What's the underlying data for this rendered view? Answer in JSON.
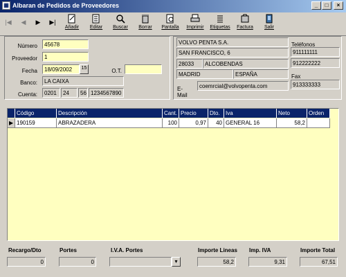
{
  "window": {
    "title": "Albaran de Pedidos de Proveedores"
  },
  "toolbar": {
    "buttons": [
      {
        "label": "Añadir"
      },
      {
        "label": "Editar"
      },
      {
        "label": "Buscar"
      },
      {
        "label": "Borrar"
      },
      {
        "label": "Pantalla"
      },
      {
        "label": "Imprimir"
      },
      {
        "label": "Etiquetas"
      },
      {
        "label": "Factura"
      },
      {
        "label": "Salir"
      }
    ]
  },
  "form": {
    "numero_label": "Número",
    "numero": "45678",
    "proveedor_label": "Proveedor",
    "proveedor": "1",
    "fecha_label": "Fecha",
    "fecha": "18/09/2002",
    "calendar_day": "15",
    "ot_label": "O.T.",
    "ot": "",
    "banco_label": "Banco:",
    "banco": "LA CAIXA",
    "cuenta_label": "Cuenta:",
    "cuenta": [
      "0201",
      "24",
      "56",
      "1234567890"
    ]
  },
  "supplier": {
    "name": "VOLVO PENTA S.A.",
    "address": "SAN FRANCISCO, 6",
    "cp": "28033",
    "city": "ALCOBENDAS",
    "province": "MADRID",
    "country": "ESPAÑA",
    "email_label": "E-Mail",
    "email": "coemrcial@volvopenta.com",
    "phones_label": "Teléfonos",
    "phone1": "911111111",
    "phone2": "912222222",
    "fax_label": "Fax",
    "fax": "913333333"
  },
  "grid": {
    "columns": [
      "Código",
      "Descripción",
      "Cant.",
      "Precio",
      "Dto.",
      "Iva",
      "Neto",
      "Orden"
    ],
    "rows": [
      {
        "codigo": "190159",
        "descripcion": "ABRAZADERA",
        "cant": "100",
        "precio": "0,97",
        "dto": "40",
        "iva": "GENERAL 16",
        "neto": "58,2",
        "orden": ""
      }
    ]
  },
  "footer": {
    "recargo_label": "Recargo/Dto",
    "recargo": "0",
    "portes_label": "Portes",
    "portes": "0",
    "iva_portes_label": "I.V.A. Portes",
    "iva_portes": "",
    "importe_lineas_label": "Importe Lineas",
    "importe_lineas": "58,2",
    "imp_iva_label": "Imp. IVA",
    "imp_iva": "9,31",
    "importe_total_label": "Importe Total",
    "importe_total": "67,51"
  }
}
